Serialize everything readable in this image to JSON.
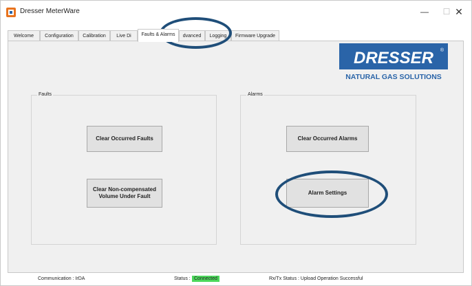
{
  "window": {
    "title": "Dresser MeterWare",
    "minimize_glyph": "—",
    "maximize_glyph": "☐",
    "close_glyph": "✕"
  },
  "tabs": [
    {
      "label": "Welcome"
    },
    {
      "label": "Configuration"
    },
    {
      "label": "Calibration"
    },
    {
      "label": "Live Di"
    },
    {
      "label": "Faults & Alarms",
      "active": true
    },
    {
      "label": "dvanced"
    },
    {
      "label": "Logging"
    },
    {
      "label": "Firmware Upgrade"
    }
  ],
  "logo": {
    "brand": "DRESSER",
    "registered_mark": "®",
    "tagline": "NATURAL GAS SOLUTIONS",
    "background": "#2a64a8"
  },
  "faults": {
    "group_label": "Faults",
    "clear_occurred_label": "Clear Occurred Faults",
    "clear_noncomp_line1": "Clear Non-compensated",
    "clear_noncomp_line2": "Volume Under Fault"
  },
  "alarms": {
    "group_label": "Alarms",
    "clear_occurred_label": "Clear Occurred Alarms",
    "settings_label": "Alarm Settings"
  },
  "status": {
    "communication": "Communication : IrDA",
    "status_label": "Status :",
    "status_value": "Connected",
    "rxtx": "Rx/Tx Status : Upload Operation Successful"
  },
  "colors": {
    "accent_callout": "#1f4e79",
    "connected_bg": "#4cd95c",
    "logo_blue": "#2a64a8"
  },
  "icons": {
    "app": "dresser-app-icon",
    "window_controls": [
      "minimize-icon",
      "maximize-icon",
      "close-icon"
    ]
  }
}
